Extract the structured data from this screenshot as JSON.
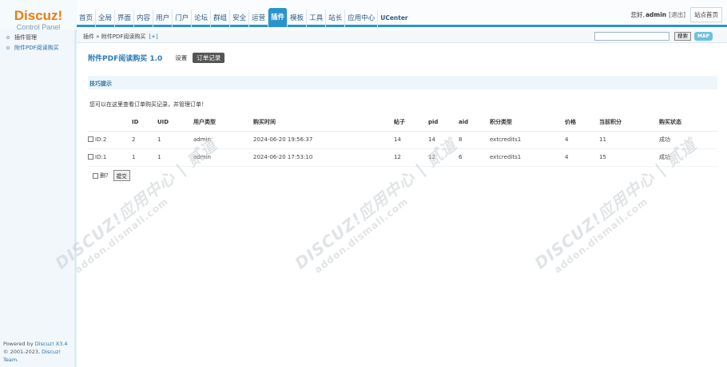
{
  "logo": {
    "main": "Discuz!",
    "sub": "Control Panel"
  },
  "nav": [
    "首页",
    "全局",
    "界面",
    "内容",
    "用户",
    "门户",
    "论坛",
    "群组",
    "安全",
    "运营",
    "插件",
    "模板",
    "工具",
    "站长",
    "应用中心",
    "UCenter"
  ],
  "top": {
    "greeting": "您好,",
    "username": "admin",
    "logout": "[退出]",
    "home": "站点首页"
  },
  "sidebar": {
    "items": [
      "插件管理",
      "附件PDF阅读购买"
    ],
    "powered": "Powered by",
    "product": "Discuz! X3.4",
    "copyright": "© 2001-2023,",
    "team": "Discuz! Team."
  },
  "breadcrumb": {
    "text": "插件 » 附件PDF阅读购买",
    "add": "[+]"
  },
  "search": {
    "button": "搜索",
    "map": "MAP"
  },
  "page": {
    "title": "附件PDF阅读购买 1.0",
    "tab_settings": "设置",
    "tab_orders": "订单记录"
  },
  "tip": {
    "title": "技巧提示",
    "text": "您可以在这里查看订单购买记录，并管理订单！"
  },
  "table": {
    "headers": [
      "ID",
      "UID",
      "用户类型",
      "购买时间",
      "帖子",
      "pid",
      "aid",
      "积分类型",
      "价格",
      "当前积分",
      "购买状态"
    ],
    "rows": [
      {
        "select": "ID:2",
        "id": "2",
        "uid": "1",
        "usertype": "admin",
        "time": "2024-06-20 19:56:37",
        "tid": "14",
        "pid": "14",
        "aid": "8",
        "credit": "extcredits1",
        "price": "4",
        "current": "11",
        "status": "成功"
      },
      {
        "select": "ID:1",
        "id": "1",
        "uid": "1",
        "usertype": "admin",
        "time": "2024-06-20 17:53:10",
        "tid": "12",
        "pid": "12",
        "aid": "6",
        "credit": "extcredits1",
        "price": "4",
        "current": "15",
        "status": "成功"
      }
    ]
  },
  "actions": {
    "delete_label": "删?",
    "submit": "提交"
  },
  "watermark": {
    "line1": "DISCUZ!应用中心 | 贰道",
    "line2": "addon.dismall.com"
  }
}
